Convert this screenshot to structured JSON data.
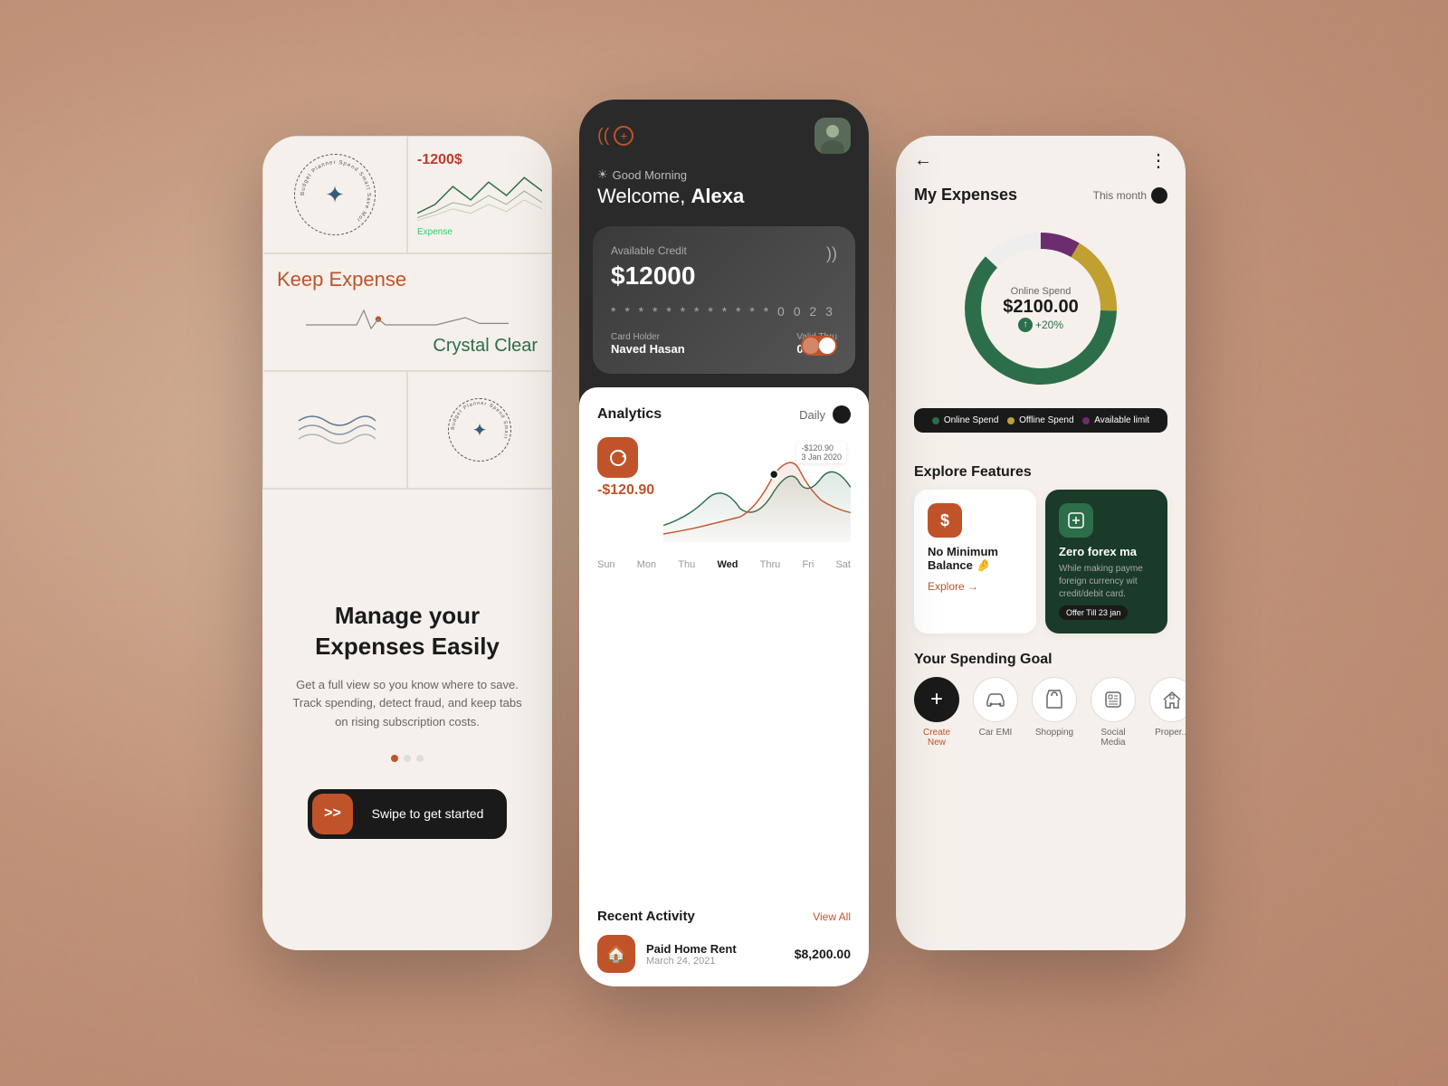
{
  "background_color": "#c9a48a",
  "phones": {
    "phone1": {
      "grid": {
        "cell1_logo_text": "Budget Planner Spend Smart Save Mor",
        "cell2_value": "-1200$",
        "cell2_label": "Expense",
        "cell3_text1": "Keep Expense",
        "cell3_text2": "Crystal Clear",
        "cell4_waves": "waves",
        "cell5_logo_text": "Budget Planner"
      },
      "heading": "Manage your Expenses Easily",
      "subtext": "Get a full view so you know where to save. Track spending, detect fraud, and keep tabs on rising subscription costs.",
      "dots": [
        "active",
        "inactive",
        "inactive"
      ],
      "cta_icon": ">>",
      "cta_label": "Swipe to get started"
    },
    "phone2": {
      "logo_left": "((",
      "logo_plus": "+",
      "greeting_icon": "☀",
      "greeting_text": "Good Morning",
      "welcome_prefix": "Welcome,",
      "welcome_name": "Alexa",
      "card": {
        "available_credit_label": "Available Credit",
        "amount": "$12000",
        "card_number": "* * * *   * * * *   * * * *   0 0 2 3",
        "holder_label": "Card Holder",
        "holder_name": "Naved Hasan",
        "valid_label": "Valid Thru",
        "valid_date": "08/25",
        "nfc_icon": "))"
      },
      "analytics": {
        "title": "Analytics",
        "filter": "Daily",
        "value": "-$120.90",
        "annotation": "-$120.90",
        "annotation_date": "3 Jan 2020",
        "days": [
          "Sun",
          "Mon",
          "Thu",
          "Wed",
          "Thru",
          "Fri",
          "Sat"
        ]
      },
      "recent": {
        "title": "Recent Activity",
        "view_all": "View All",
        "item_icon": "🏠",
        "item_name": "Paid Home Rent",
        "item_date": "March 24, 2021",
        "item_amount": "$8,200.00"
      }
    },
    "phone3": {
      "back_icon": "←",
      "more_icon": "⋮",
      "expenses": {
        "title": "My Expenses",
        "period": "This month",
        "donut_label": "Online Spend",
        "donut_value": "$2100.00",
        "donut_change": "+20%",
        "legend": [
          {
            "label": "Online Spend",
            "color": "#2d6e4a"
          },
          {
            "label": "Offline Spend",
            "color": "#c0a030"
          },
          {
            "label": "Available limit",
            "color": "#6b2d6e"
          }
        ]
      },
      "explore": {
        "title": "Explore Features",
        "card1": {
          "icon": "$",
          "title": "No Minimum Balance 🤌",
          "link": "Explore →"
        },
        "card2": {
          "icon": "◈",
          "title": "Zero forex ma",
          "desc": "While making payme foreign currency wit credit/debit card.",
          "offer": "Offer Till 23 jan"
        }
      },
      "goals": {
        "title": "Your Spending Goal",
        "items": [
          {
            "icon": "+",
            "label": "Create New",
            "primary": true
          },
          {
            "icon": "🚗",
            "label": "Car EMI"
          },
          {
            "icon": "🛍",
            "label": "Shopping"
          },
          {
            "icon": "📱",
            "label": "Social Media"
          },
          {
            "icon": "🏢",
            "label": "Proper..."
          }
        ]
      }
    }
  }
}
